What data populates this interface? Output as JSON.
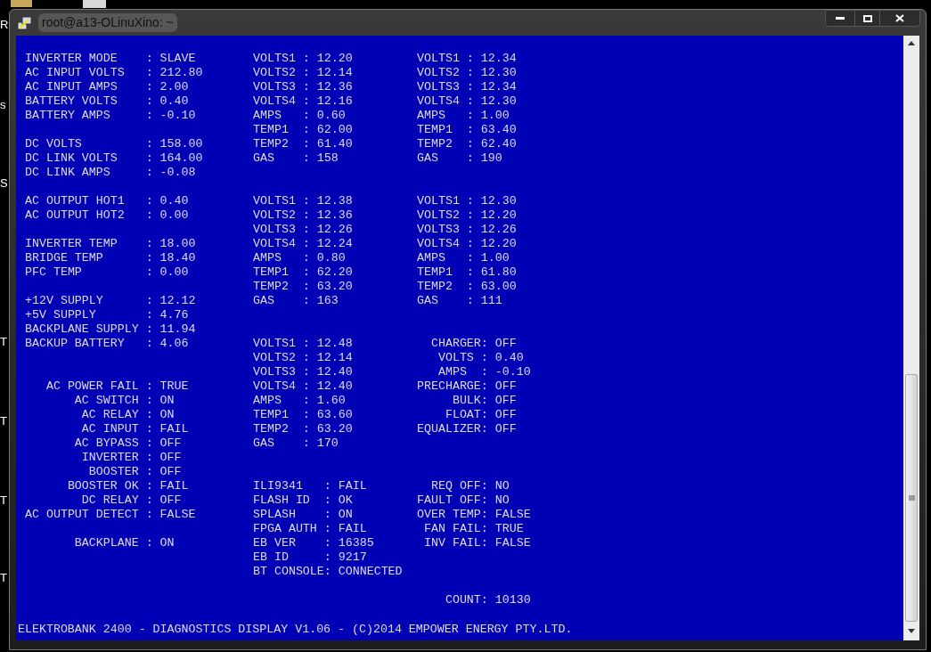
{
  "desktop_labels": [
    "R",
    "s",
    "S",
    "T",
    "T",
    "T",
    "T"
  ],
  "window": {
    "title": "root@a13-OLinuXino: ~"
  },
  "terminal": {
    "rows": [
      {
        "left": "INVERTER MODE    : SLAVE",
        "middle": "VOLTS1 : 12.20",
        "right": "VOLTS1 : 12.34"
      },
      {
        "left": "AC INPUT VOLTS   : 212.80",
        "middle": "VOLTS2 : 12.14",
        "right": "VOLTS2 : 12.30"
      },
      {
        "left": "AC INPUT AMPS    : 2.00",
        "middle": "VOLTS3 : 12.36",
        "right": "VOLTS3 : 12.34"
      },
      {
        "left": "BATTERY VOLTS    : 0.40",
        "middle": "VOLTS4 : 12.16",
        "right": "VOLTS4 : 12.30"
      },
      {
        "left": "BATTERY AMPS     : -0.10",
        "middle": "AMPS   : 0.60",
        "right": "AMPS   : 1.00"
      },
      {
        "middle": "TEMP1  : 62.00",
        "right": "TEMP1  : 63.40"
      },
      {
        "left": "DC VOLTS         : 158.00",
        "middle": "TEMP2  : 61.40",
        "right": "TEMP2  : 62.40"
      },
      {
        "left": "DC LINK VOLTS    : 164.00",
        "middle": "GAS    : 158",
        "right": "GAS    : 190"
      },
      {
        "left": "DC LINK AMPS     : -0.08"
      },
      {},
      {
        "left": "AC OUTPUT HOT1   : 0.40",
        "middle": "VOLTS1 : 12.38",
        "right": "VOLTS1 : 12.30"
      },
      {
        "left": "AC OUTPUT HOT2   : 0.00",
        "middle": "VOLTS2 : 12.36",
        "right": "VOLTS2 : 12.20"
      },
      {
        "middle": "VOLTS3 : 12.26",
        "right": "VOLTS3 : 12.26"
      },
      {
        "left": "INVERTER TEMP    : 18.00",
        "middle": "VOLTS4 : 12.24",
        "right": "VOLTS4 : 12.20"
      },
      {
        "left": "BRIDGE TEMP      : 18.40",
        "middle": "AMPS   : 0.80",
        "right": "AMPS   : 1.00"
      },
      {
        "left": "PFC TEMP         : 0.00",
        "middle": "TEMP1  : 62.20",
        "right": "TEMP1  : 61.80"
      },
      {
        "middle": "TEMP2  : 63.20",
        "right": "TEMP2  : 63.00"
      },
      {
        "left": "+12V SUPPLY      : 12.12",
        "middle": "GAS    : 163",
        "right": "GAS    : 111"
      },
      {
        "left": "+5V SUPPLY       : 4.76"
      },
      {
        "left": "BACKPLANE SUPPLY : 11.94"
      },
      {
        "left": "BACKUP BATTERY   : 4.06",
        "middle": "VOLTS1 : 12.48",
        "right": "  CHARGER: OFF"
      },
      {
        "middle": "VOLTS2 : 12.14",
        "right": "   VOLTS : 0.40"
      },
      {
        "middle": "VOLTS3 : 12.40",
        "right": "   AMPS  : -0.10"
      },
      {
        "left": "   AC POWER FAIL : TRUE",
        "middle": "VOLTS4 : 12.40",
        "right": "PRECHARGE: OFF"
      },
      {
        "left": "       AC SWITCH : ON",
        "middle": "AMPS   : 1.60",
        "right": "     BULK: OFF"
      },
      {
        "left": "        AC RELAY : ON",
        "middle": "TEMP1  : 63.60",
        "right": "    FLOAT: OFF"
      },
      {
        "left": "        AC INPUT : FAIL",
        "middle": "TEMP2  : 63.20",
        "right": "EQUALIZER: OFF"
      },
      {
        "left": "       AC BYPASS : OFF",
        "middle": "GAS    : 170"
      },
      {
        "left": "        INVERTER : OFF"
      },
      {
        "left": "         BOOSTER : OFF"
      },
      {
        "left": "      BOOSTER OK : FAIL",
        "middle": "ILI9341   : FAIL",
        "right": "  REQ OFF: NO"
      },
      {
        "left": "        DC RELAY : OFF",
        "middle": "FLASH ID  : OK",
        "right": "FAULT OFF: NO"
      },
      {
        "left": "AC OUTPUT DETECT : FALSE",
        "middle": "SPLASH    : ON",
        "right": "OVER TEMP: FALSE"
      },
      {
        "middle": "FPGA AUTH : FAIL",
        "right": " FAN FAIL: TRUE"
      },
      {
        "left": "       BACKPLANE : ON",
        "middle": "EB VER    : 16385",
        "right": " INV FAIL: FALSE"
      },
      {
        "middle": "EB ID     : 9217"
      },
      {
        "middle": "BT CONSOLE: CONNECTED"
      },
      {},
      {
        "right": "    COUNT: 10130"
      }
    ],
    "footer": "ELEKTROBANK 2400 - DIAGNOSTICS DISPLAY V1.06 - (C)2014 EMPOWER ENERGY PTY.LTD."
  }
}
